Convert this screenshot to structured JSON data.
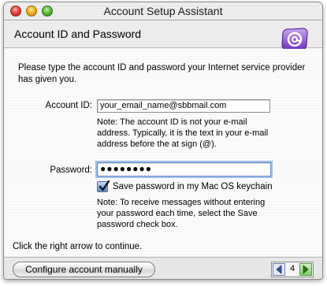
{
  "window": {
    "title": "Account Setup Assistant"
  },
  "header": {
    "title": "Account ID and Password",
    "logo_icon": "mail-at-icon"
  },
  "content": {
    "intro": "Please type the account ID and password your Internet service provider has given you.",
    "account_id_label": "Account ID:",
    "account_id_value": "your_email_name@sbbmail.com",
    "account_id_note": "Note: The account ID is not your e-mail address. Typically, it is the text in your e-mail address before the at sign (@).",
    "password_label": "Password:",
    "password_value": "●●●●●●●●",
    "save_password_label": "Save password in my Mac OS keychain",
    "save_password_checked": true,
    "save_password_note": "Note: To receive messages without entering your password each time, select the Save password check box.",
    "footer_hint": "Click the right arrow to continue."
  },
  "bottombar": {
    "configure_button_label": "Configure account manually",
    "page_number": "4"
  },
  "colors": {
    "checkbox_accent": "#5d8ccd",
    "focus_ring": "#9fc0ec",
    "next_arrow": "#5cbc3a"
  }
}
